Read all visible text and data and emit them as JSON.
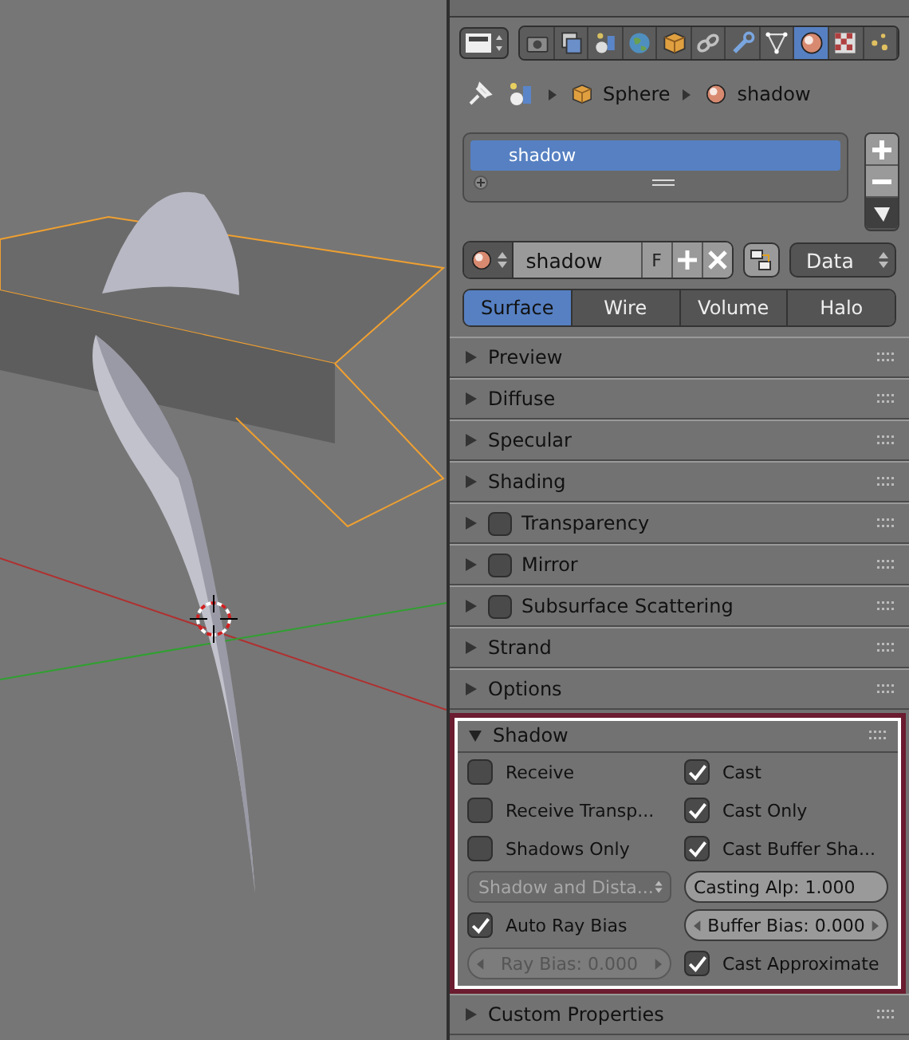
{
  "context_tabs": [
    {
      "kind": "render",
      "selected": false
    },
    {
      "kind": "layers",
      "selected": false
    },
    {
      "kind": "scene",
      "selected": false
    },
    {
      "kind": "world",
      "selected": false
    },
    {
      "kind": "object",
      "selected": false
    },
    {
      "kind": "constraints",
      "selected": false
    },
    {
      "kind": "modifiers",
      "selected": false
    },
    {
      "kind": "data",
      "selected": false
    },
    {
      "kind": "material",
      "selected": true
    },
    {
      "kind": "texture",
      "selected": false
    },
    {
      "kind": "particles",
      "selected": false
    }
  ],
  "breadcrumb": [
    "Sphere",
    "shadow"
  ],
  "material_slots": [
    {
      "name": "shadow",
      "selected": true
    }
  ],
  "datablock": {
    "name": "shadow",
    "fake_user": "F",
    "link": "Data"
  },
  "material_tabs": [
    {
      "label": "Surface",
      "selected": true
    },
    {
      "label": "Wire",
      "selected": false
    },
    {
      "label": "Volume",
      "selected": false
    },
    {
      "label": "Halo",
      "selected": false
    }
  ],
  "panels": [
    {
      "title": "Preview",
      "kind": "plain"
    },
    {
      "title": "Diffuse",
      "kind": "plain"
    },
    {
      "title": "Specular",
      "kind": "plain"
    },
    {
      "title": "Shading",
      "kind": "plain"
    },
    {
      "title": "Transparency",
      "kind": "toggle",
      "checked": false
    },
    {
      "title": "Mirror",
      "kind": "toggle",
      "checked": false
    },
    {
      "title": "Subsurface Scattering",
      "kind": "toggle",
      "checked": false
    },
    {
      "title": "Strand",
      "kind": "plain"
    },
    {
      "title": "Options",
      "kind": "plain"
    }
  ],
  "shadow_panel": {
    "title": "Shadow",
    "expanded": true,
    "left": [
      {
        "kind": "checkbox",
        "label": "Receive",
        "checked": false
      },
      {
        "kind": "checkbox",
        "label": "Receive Transp...",
        "checked": false
      },
      {
        "kind": "checkbox",
        "label": "Shadows Only",
        "checked": false
      },
      {
        "kind": "dropdown",
        "label": "Shadow and Dista...",
        "disabled": true
      },
      {
        "kind": "checkbox",
        "label": "Auto Ray Bias",
        "checked": true
      },
      {
        "kind": "number",
        "label": "Ray Bias:",
        "value": "0.000",
        "disabled": true
      }
    ],
    "right": [
      {
        "kind": "checkbox",
        "label": "Cast",
        "checked": true
      },
      {
        "kind": "checkbox",
        "label": "Cast Only",
        "checked": true
      },
      {
        "kind": "checkbox",
        "label": "Cast Buffer Sha...",
        "checked": true
      },
      {
        "kind": "slider",
        "label": "Casting Alp:",
        "value": "1.000",
        "disabled": false
      },
      {
        "kind": "number",
        "label": "Buffer Bias:",
        "value": "0.000",
        "disabled": false
      },
      {
        "kind": "checkbox",
        "label": "Cast Approximate",
        "checked": true
      }
    ]
  },
  "bottom_panels": [
    {
      "title": "Custom Properties",
      "kind": "plain"
    }
  ]
}
